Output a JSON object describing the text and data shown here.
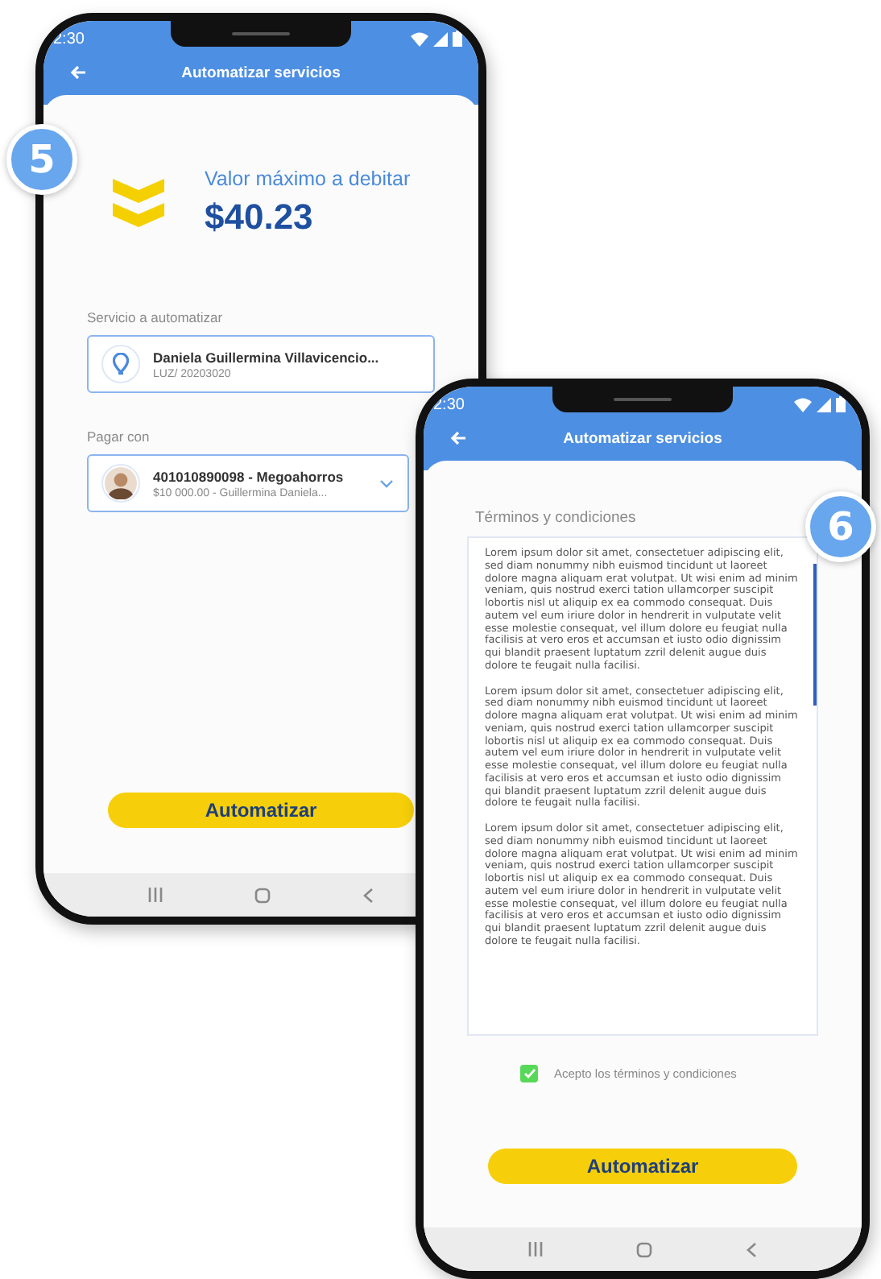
{
  "phones": [
    {
      "kind": "summary",
      "badge": "5",
      "status_time": "2:30",
      "title": "Automatizar servicios",
      "amount_label": "Valor máximo a debitar",
      "amount": "$40.23",
      "service_label": "Servicio a automatizar",
      "service": {
        "name": "Daniela Guillermina Villavicencio...",
        "detail": "LUZ/  20203020"
      },
      "pay_label": "Pagar con",
      "account": {
        "name": "401010890098 - Megoahorros",
        "detail": "$10 000.00 - Guillermina Daniela..."
      },
      "button": "Automatizar"
    },
    {
      "kind": "terms",
      "badge": "6",
      "status_time": "2:30",
      "title": "Automatizar servicios",
      "terms_label": "Términos y condiciones",
      "paragraphs": [
        "Lorem ipsum dolor sit amet, consectetuer adipiscing elit, sed diam nonummy nibh euismod tincidunt ut laoreet dolore magna aliquam erat volutpat. Ut wisi enim ad minim veniam, quis nostrud exerci tation ullamcorper suscipit lobortis nisl ut aliquip ex ea commodo consequat. Duis autem vel eum iriure dolor in hendrerit in vulputate velit esse molestie consequat, vel illum dolore eu feugiat nulla facilisis at vero eros et accumsan et iusto odio dignissim qui blandit praesent luptatum zzril delenit augue duis dolore te feugait nulla facilisi.",
        "Lorem ipsum dolor sit amet, consectetuer adipiscing elit, sed diam nonummy nibh euismod tincidunt ut laoreet dolore magna aliquam erat volutpat. Ut wisi enim ad minim veniam, quis nostrud exerci tation ullamcorper suscipit lobortis nisl ut aliquip ex ea commodo consequat. Duis autem vel eum iriure dolor in hendrerit in vulputate velit esse molestie consequat, vel illum dolore eu feugiat nulla facilisis at vero eros et accumsan et iusto odio dignissim qui blandit praesent luptatum zzril delenit augue duis dolore te feugait nulla facilisi.",
        "Lorem ipsum dolor sit amet, consectetuer adipiscing elit, sed diam nonummy nibh euismod tincidunt ut laoreet dolore magna aliquam erat volutpat. Ut wisi enim ad minim veniam, quis nostrud exerci tation ullamcorper suscipit lobortis nisl ut aliquip ex ea commodo consequat. Duis autem vel eum iriure dolor in hendrerit in vulputate velit esse molestie consequat, vel illum dolore eu feugiat nulla facilisis at vero eros et accumsan et iusto odio dignissim qui blandit praesent luptatum zzril delenit augue duis dolore te feugait nulla facilisi."
      ],
      "accept": {
        "label": "Acepto los términos y condiciones",
        "checked": true
      },
      "button": "Automatizar"
    }
  ]
}
